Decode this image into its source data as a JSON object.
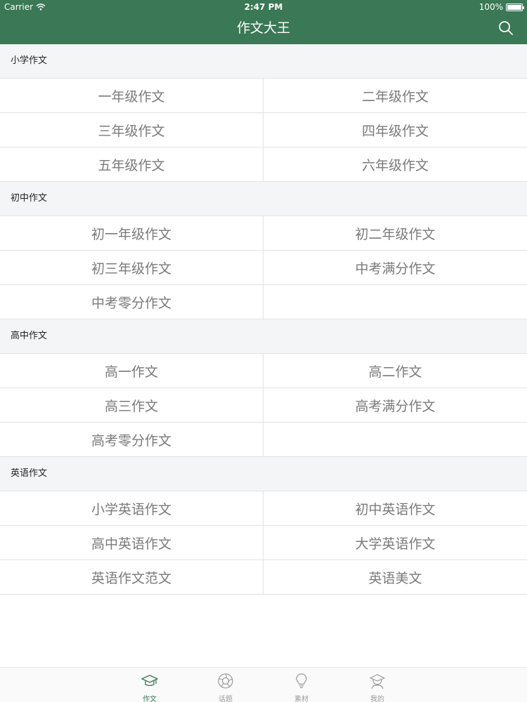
{
  "status": {
    "carrier": "Carrier",
    "time": "2:47 PM",
    "battery": "100%"
  },
  "nav": {
    "title": "作文大王",
    "search_icon": "search-icon"
  },
  "sections": [
    {
      "title": "小学作文",
      "items": [
        "一年级作文",
        "二年级作文",
        "三年级作文",
        "四年级作文",
        "五年级作文",
        "六年级作文"
      ]
    },
    {
      "title": "初中作文",
      "items": [
        "初一年级作文",
        "初二年级作文",
        "初三年级作文",
        "中考满分作文",
        "中考零分作文",
        ""
      ]
    },
    {
      "title": "高中作文",
      "items": [
        "高一作文",
        "高二作文",
        "高三作文",
        "高考满分作文",
        "高考零分作文",
        ""
      ]
    },
    {
      "title": "英语作文",
      "items": [
        "小学英语作文",
        "初中英语作文",
        "高中英语作文",
        "大学英语作文",
        "英语作文范文",
        "英语美文"
      ]
    }
  ],
  "tabs": [
    {
      "label": "作文",
      "icon": "graduation-cap-icon",
      "active": true
    },
    {
      "label": "话题",
      "icon": "aperture-icon",
      "active": false
    },
    {
      "label": "素材",
      "icon": "lightbulb-icon",
      "active": false
    },
    {
      "label": "我的",
      "icon": "user-icon",
      "active": false
    }
  ],
  "colors": {
    "brand": "#3a7856",
    "section_bg": "#f4f5f6",
    "cell_text": "#7a7a7a"
  }
}
